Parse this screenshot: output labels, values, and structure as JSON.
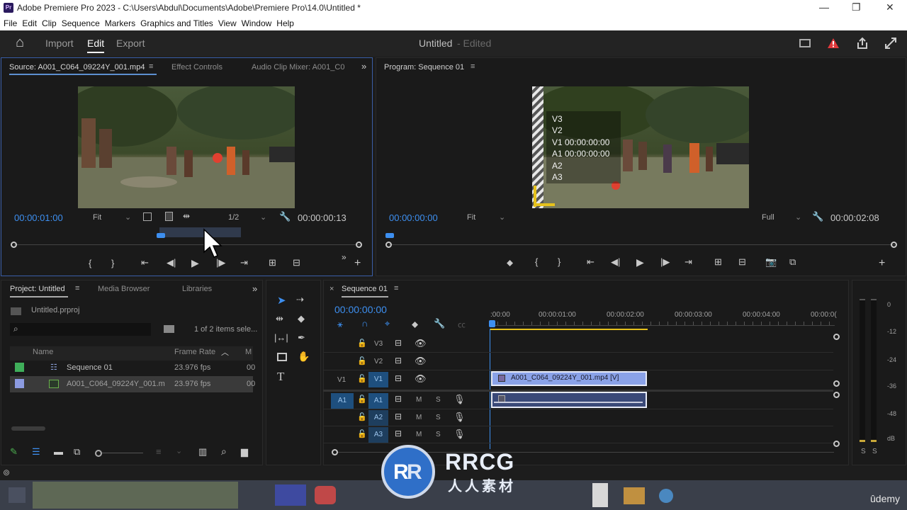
{
  "titlebar": {
    "app": "Pr",
    "title": "Adobe Premiere Pro 2023 - C:\\Users\\Abdul\\Documents\\Adobe\\Premiere Pro\\14.0\\Untitled *",
    "minimize": "—",
    "restore": "❐",
    "close": "✕"
  },
  "menu": [
    "File",
    "Edit",
    "Clip",
    "Sequence",
    "Markers",
    "Graphics and Titles",
    "View",
    "Window",
    "Help"
  ],
  "header": {
    "home": "⌂",
    "import": "Import",
    "edit": "Edit",
    "export": "Export",
    "doc_title": "Untitled",
    "doc_status": "- Edited"
  },
  "source": {
    "tab": "Source: A001_C064_09224Y_001.mp4",
    "tab2": "Effect Controls",
    "tab3": "Audio Clip Mixer: A001_C0",
    "timecode": "00:00:01:00",
    "fit": "Fit",
    "res": "1/2",
    "duration": "00:00:00:13"
  },
  "program": {
    "tab": "Program: Sequence 01",
    "timecode": "00:00:00:00",
    "fit": "Fit",
    "res": "Full",
    "duration": "00:00:02:08",
    "overlay": [
      "V3",
      "V2",
      "V1 00:00:00:00",
      "A1 00:00:00:00",
      "A2",
      "A3"
    ]
  },
  "project": {
    "tab": "Project: Untitled",
    "tab2": "Media Browser",
    "tab3": "Libraries",
    "file": "Untitled.prproj",
    "count": "1 of 2 items sele...",
    "col_name": "Name",
    "col_rate": "Frame Rate",
    "col_m": "M",
    "rows": [
      {
        "name": "Sequence 01",
        "rate": "23.976 fps",
        "m": "00",
        "color": "#3fae5a"
      },
      {
        "name": "A001_C064_09224Y_001.m",
        "rate": "23.976 fps",
        "m": "00",
        "color": "#8c9be0"
      }
    ]
  },
  "timeline": {
    "tab": "Sequence 01",
    "timecode": "00:00:00:00",
    "ruler": [
      ":00:00",
      "00:00:01:00",
      "00:00:02:00",
      "00:00:03:00",
      "00:00:04:00",
      "00:00:0("
    ],
    "tracks": {
      "v3": "V3",
      "v2": "V2",
      "v1": "V1",
      "a1": "A1",
      "a2": "A2",
      "a3": "A3",
      "src_v1": "V1",
      "src_a1": "A1"
    },
    "clip_video": "A001_C064_09224Y_001.mp4 [V]",
    "m": "M",
    "s": "S"
  },
  "meter": {
    "ticks": [
      "0",
      "-12",
      "-24",
      "-36",
      "-48",
      "dB"
    ],
    "solo": [
      "S",
      "S"
    ]
  },
  "watermark": {
    "logo": "RRCG",
    "sub": "人人素材"
  },
  "udemy": "ûdemy",
  "colors": {
    "accent": "#3d8ff0",
    "warning": "#e0383b",
    "clip_video": "#8aa2e8",
    "clip_audio": "#3a4978",
    "playhead": "#3d8ff0"
  }
}
